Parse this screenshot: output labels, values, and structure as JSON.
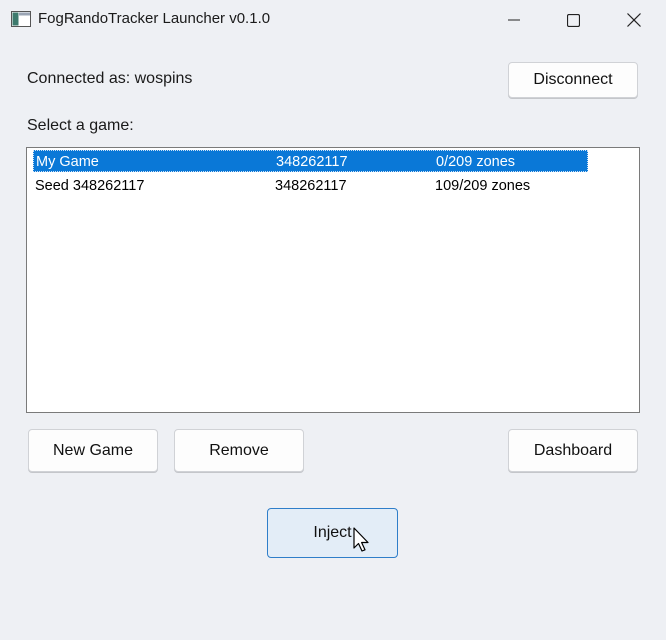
{
  "window": {
    "title": "FogRandoTracker Launcher v0.1.0",
    "controls": [
      "minimize-icon",
      "maximize-icon",
      "close-icon"
    ]
  },
  "account": {
    "status_text": "Connected as: wospins",
    "disconnect_label": "Disconnect"
  },
  "games": {
    "section_label": "Select a game:",
    "rows": [
      {
        "name": "My Game",
        "seed": "348262117",
        "zones": "0/209 zones",
        "selected": true
      },
      {
        "name": "Seed 348262117",
        "seed": "348262117",
        "zones": "109/209 zones",
        "selected": false
      }
    ]
  },
  "actions": {
    "new_game_label": "New Game",
    "remove_label": "Remove",
    "dashboard_label": "Dashboard",
    "inject_label": "Inject"
  },
  "colors": {
    "selection": "#0a78d7",
    "window_bg": "#eef0f4",
    "inject_border": "#2f7ec9"
  }
}
